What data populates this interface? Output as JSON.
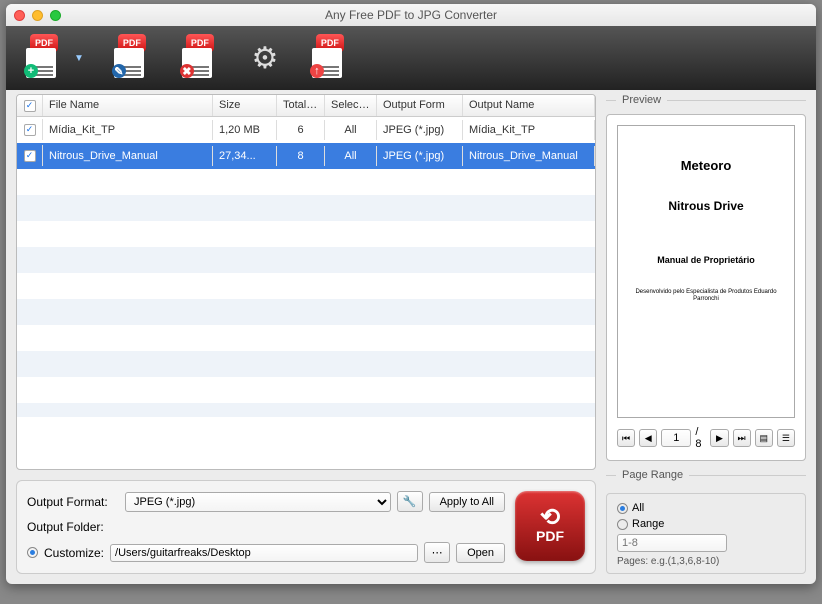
{
  "window": {
    "title": "Any Free PDF to JPG Converter"
  },
  "toolbar": {
    "pdf_label": "PDF"
  },
  "columns": {
    "chk": "",
    "name": "File Name",
    "size": "Size",
    "total": "Total Pa",
    "selected": "Selected",
    "format": "Output Form",
    "outname": "Output Name"
  },
  "files": [
    {
      "checked": true,
      "selected": false,
      "name": "Mídia_Kit_TP",
      "size": "1,20 MB",
      "total": "6",
      "sel": "All",
      "fmt": "JPEG (*.jpg)",
      "out": "Mídia_Kit_TP"
    },
    {
      "checked": true,
      "selected": true,
      "name": "Nitrous_Drive_Manual",
      "size": "27,34...",
      "total": "8",
      "sel": "All",
      "fmt": "JPEG (*.jpg)",
      "out": "Nitrous_Drive_Manual"
    }
  ],
  "output": {
    "format_label": "Output Format:",
    "format_value": "JPEG (*.jpg)",
    "apply_all": "Apply to All",
    "folder_label": "Output Folder:",
    "customize_label": "Customize:",
    "folder_path": "/Users/guitarfreaks/Desktop",
    "open": "Open",
    "big_label": "PDF"
  },
  "preview": {
    "title": "Preview",
    "doc_title1": "Meteoro",
    "doc_title2": "Nitrous Drive",
    "doc_title3": "Manual de Proprietário",
    "doc_title4": "Desenvolvido pelo Especialista de Produtos Eduardo Parronchi",
    "page_current": "1",
    "page_total": "/ 8"
  },
  "range": {
    "title": "Page Range",
    "all": "All",
    "range": "Range",
    "placeholder": "1-8",
    "hint": "Pages: e.g.(1,3,6,8-10)"
  }
}
